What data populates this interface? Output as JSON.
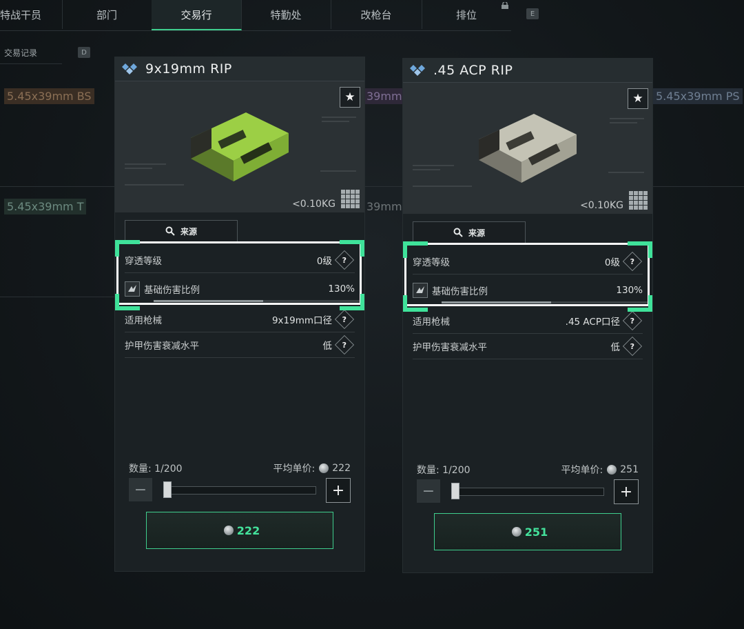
{
  "nav": {
    "tabs": [
      "特战干员",
      "部门",
      "交易行",
      "特勤处",
      "改枪台",
      "排位"
    ],
    "active_tab": "交易行",
    "key_hint": "E"
  },
  "history": {
    "label": "交易记录",
    "key_hint": "D"
  },
  "background_items": [
    "5.45x39mm BS",
    "39mm",
    "5.45x39mm PS",
    "5.45x39mm T",
    "39mm"
  ],
  "accent_color": "#3fcf8e",
  "cards": [
    {
      "title": "9x19mm RIP",
      "weight": "<0.10KG",
      "source_label": "来源",
      "stats": [
        {
          "label": "穿透等级",
          "value": "0级"
        },
        {
          "label": "基础伤害比例",
          "value": "130%",
          "bar_fraction": 0.52
        },
        {
          "label": "适用枪械",
          "value": "9x19mm口径"
        },
        {
          "label": "护甲伤害衰减水平",
          "value": "低"
        }
      ],
      "quantity_label": "数量: 1/200",
      "avg_price_label": "平均单价:",
      "avg_price": "222",
      "buy_price": "222",
      "box_color": "#8fc23f"
    },
    {
      "title": ".45 ACP RIP",
      "weight": "<0.10KG",
      "source_label": "来源",
      "stats": [
        {
          "label": "穿透等级",
          "value": "0级"
        },
        {
          "label": "基础伤害比例",
          "value": "130%",
          "bar_fraction": 0.52
        },
        {
          "label": "适用枪械",
          "value": ".45 ACP口径"
        },
        {
          "label": "护甲伤害衰减水平",
          "value": "低"
        }
      ],
      "quantity_label": "数量: 1/200",
      "avg_price_label": "平均单价:",
      "avg_price": "251",
      "buy_price": "251",
      "box_color": "#b7b7a8"
    }
  ]
}
